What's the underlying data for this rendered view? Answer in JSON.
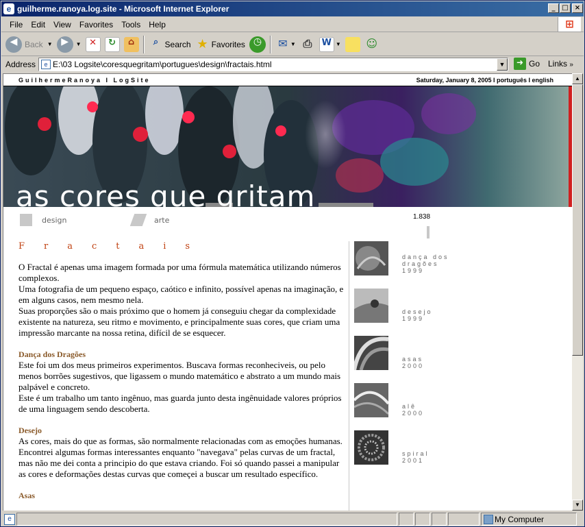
{
  "window": {
    "title": "guilherme.ranoya.log.site - Microsoft Internet Explorer"
  },
  "menu": [
    "File",
    "Edit",
    "View",
    "Favorites",
    "Tools",
    "Help"
  ],
  "toolbar": {
    "back": "Back",
    "search": "Search",
    "favorites": "Favorites"
  },
  "address": {
    "label": "Address",
    "url": "E:\\03 Logsite\\coresquegritam\\portugues\\design\\fractais.html",
    "go": "Go",
    "links": "Links"
  },
  "site": {
    "brand": "GuilhermeRanoya  I  LogSite",
    "dateline": "Saturday, January 8, 2005 I português I english",
    "banner_title": "as cores que gritam",
    "nav": [
      {
        "label": "design",
        "icon": "design-icon"
      },
      {
        "label": "arte",
        "icon": "arte-icon"
      }
    ],
    "counter": "1.838"
  },
  "article": {
    "title": "Fractais",
    "intro": "O Fractal é apenas uma imagem formada por uma fórmula matemática utilizando números complexos.\nUma fotografia de um pequeno espaço, caótico e infinito, possível apenas na imaginação, e em alguns casos, nem mesmo nela.\nSuas proporções são o mais próximo que o homem já conseguiu chegar da complexidade existente na natureza, seu ritmo e movimento, e principalmente suas cores, que criam uma impressão marcante na nossa retina, difícil de se esquecer.",
    "sections": [
      {
        "heading": "Dança dos Dragões",
        "text": "Este foi um dos meus primeiros experimentos. Buscava formas reconheciveis, ou pelo menos borrões sugestivos, que ligassem o mundo matemático e abstrato a um mundo mais palpável e concreto.\nEste é um trabalho um tanto ingênuo, mas guarda junto desta ingênuidade valores próprios de uma linguagem sendo descoberta."
      },
      {
        "heading": "Desejo",
        "text": "As cores, mais do que as formas, são normalmente relacionadas com as emoções humanas. Encontrei algumas formas interessantes enquanto \"navegava\" pelas curvas de um fractal, mas não me dei conta a principio do que estava criando. Foi só quando passei a manipular as cores e deformações destas curvas que começei a buscar um resultado específico."
      },
      {
        "heading": "Asas",
        "text": ""
      }
    ]
  },
  "gallery": [
    {
      "title": "dança dos dragões",
      "year": "1999"
    },
    {
      "title": "desejo",
      "year": "1999"
    },
    {
      "title": "asas",
      "year": "2000"
    },
    {
      "title": "alê",
      "year": "2000"
    },
    {
      "title": "spiral",
      "year": "2001"
    }
  ],
  "status": {
    "zone": "My Computer"
  }
}
